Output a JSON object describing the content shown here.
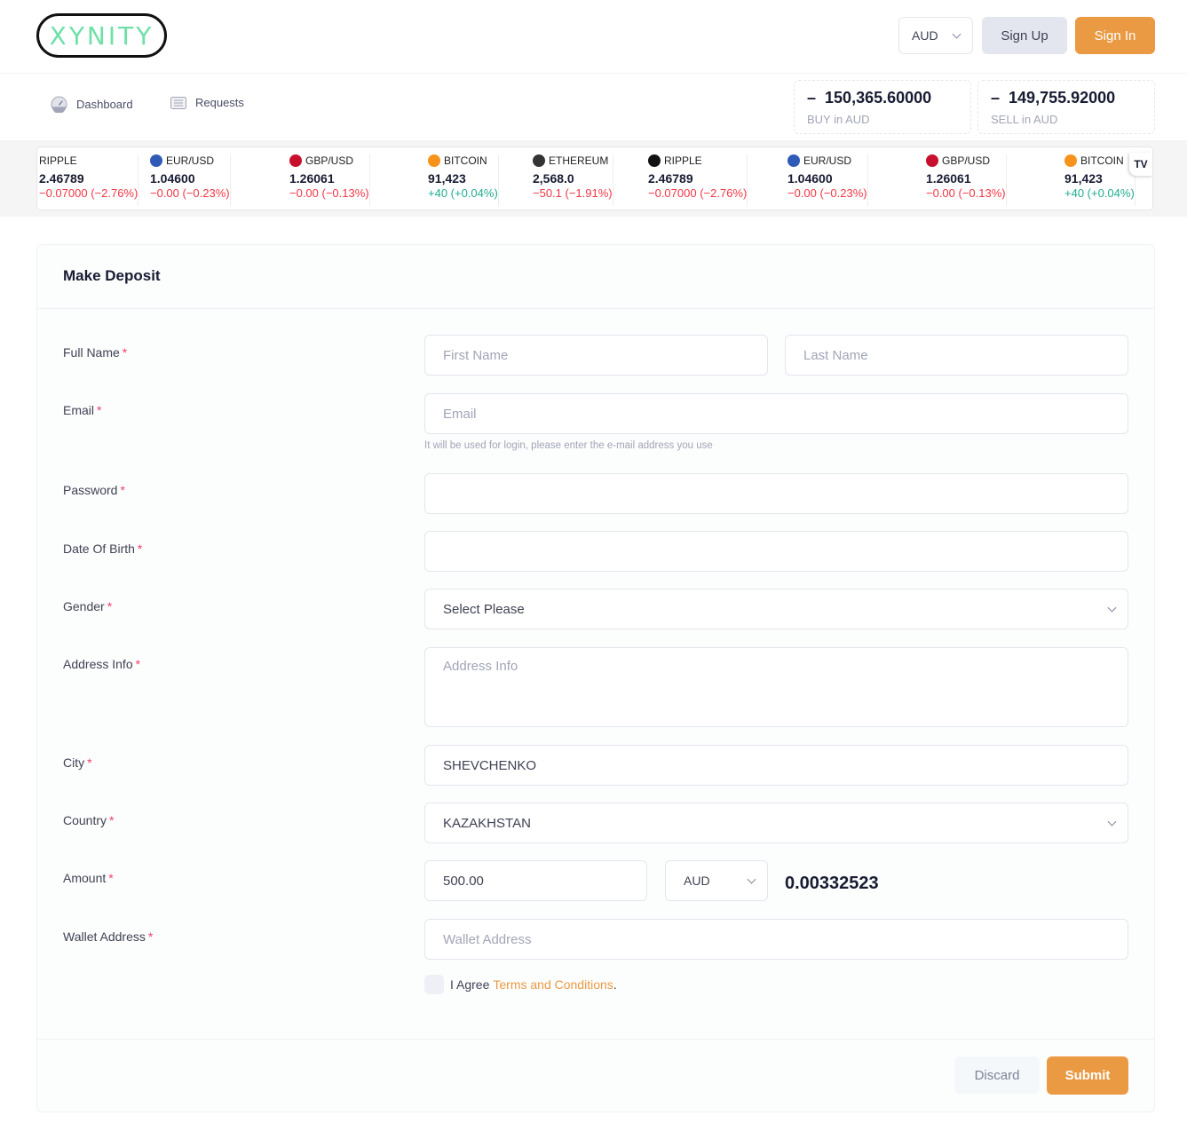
{
  "header": {
    "logo": "XYNITY",
    "currency": "AUD",
    "sign_up": "Sign Up",
    "sign_in": "Sign In"
  },
  "nav": {
    "dashboard": "Dashboard",
    "requests": "Requests"
  },
  "stats": {
    "buy_value": "150,365.60000",
    "buy_label": "BUY in AUD",
    "sell_value": "149,755.92000",
    "sell_label": "SELL in AUD",
    "dash": "–"
  },
  "ticker": [
    {
      "name": "RIPPLE",
      "price": "2.46789",
      "change": "−0.07000 (−2.76%)",
      "dir": "neg"
    },
    {
      "name": "EUR/USD",
      "price": "1.04600",
      "change": "−0.00 (−0.23%)",
      "dir": "neg"
    },
    {
      "name": "GBP/USD",
      "price": "1.26061",
      "change": "−0.00 (−0.13%)",
      "dir": "neg"
    },
    {
      "name": "BITCOIN",
      "price": "91,423",
      "change": "+40 (+0.04%)",
      "dir": "pos"
    },
    {
      "name": "ETHEREUM",
      "price": "2,568.0",
      "change": "−50.1 (−1.91%)",
      "dir": "neg"
    },
    {
      "name": "RIPPLE",
      "price": "2.46789",
      "change": "−0.07000 (−2.76%)",
      "dir": "neg"
    },
    {
      "name": "EUR/USD",
      "price": "1.04600",
      "change": "−0.00 (−0.23%)",
      "dir": "neg"
    },
    {
      "name": "GBP/USD",
      "price": "1.26061",
      "change": "−0.00 (−0.13%)",
      "dir": "neg"
    },
    {
      "name": "BITCOIN",
      "price": "91,423",
      "change": "+40 (+0.04%)",
      "dir": "pos"
    }
  ],
  "ticker_logo": "TV",
  "form": {
    "title": "Make Deposit",
    "labels": {
      "full_name": "Full Name",
      "email": "Email",
      "password": "Password",
      "dob": "Date Of Birth",
      "gender": "Gender",
      "address": "Address Info",
      "city": "City",
      "country": "Country",
      "amount": "Amount",
      "wallet": "Wallet Address"
    },
    "required": "*",
    "placeholders": {
      "first_name": "First Name",
      "last_name": "Last Name",
      "email": "Email",
      "address": "Address Info",
      "wallet": "Wallet Address"
    },
    "email_help": "It will be used for login, please enter the e-mail address you use",
    "gender": "Select Please",
    "city": "SHEVCHENKO",
    "country": "KAZAKHSTAN",
    "amount": "500.00",
    "amount_currency": "AUD",
    "converted": "0.00332523",
    "agree": "I Agree",
    "terms": "Terms and Conditions",
    "discard": "Discard",
    "submit": "Submit"
  },
  "colors": {
    "accent": "#ea9a43",
    "logo": "#6ee0a8",
    "negative": "#f23645",
    "positive": "#22ab94"
  }
}
